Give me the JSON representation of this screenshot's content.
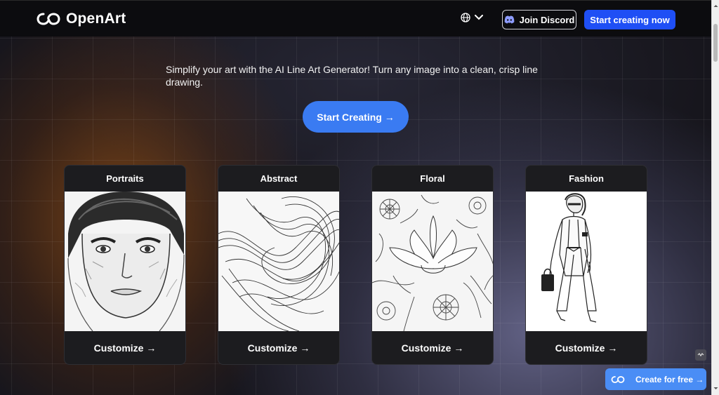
{
  "header": {
    "brand": "OpenArt",
    "language_icon": "globe-icon",
    "discord_label": "Join Discord",
    "start_now_label": "Start creating now"
  },
  "hero": {
    "tagline": "Simplify your art with the AI Line Art Generator! Turn any image into a clean, crisp line drawing.",
    "cta_label": "Start Creating →"
  },
  "cards": [
    {
      "title": "Portraits",
      "button": "Customize →"
    },
    {
      "title": "Abstract",
      "button": "Customize →"
    },
    {
      "title": "Floral",
      "button": "Customize →"
    },
    {
      "title": "Fashion",
      "button": "Customize →"
    }
  ],
  "floating": {
    "create_free_label": "Create for free →"
  },
  "colors": {
    "primary_blue": "#1f4ff5",
    "cta_blue": "#3a7bf2",
    "floating_blue": "#4a8df5",
    "topbar": "#0c0c0f",
    "card_bg": "#1c1c1f"
  }
}
